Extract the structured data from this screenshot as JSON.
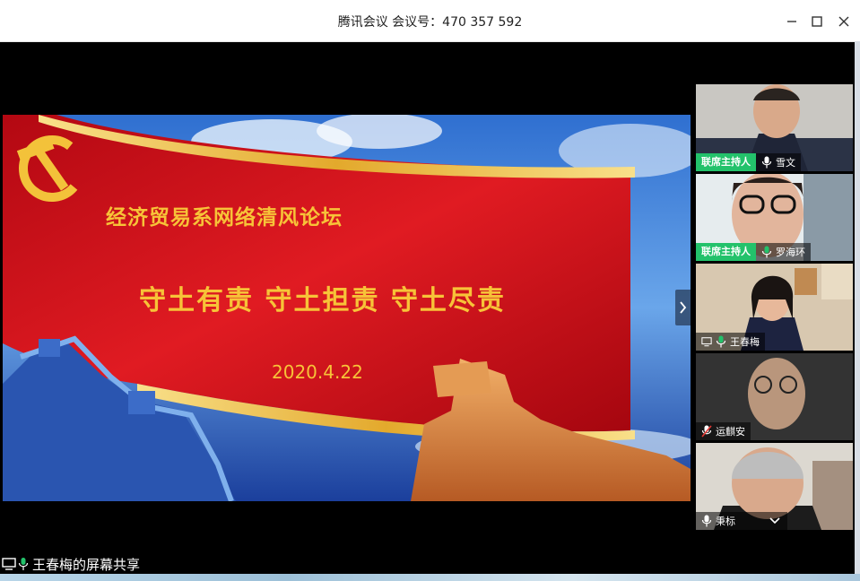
{
  "window": {
    "title": "腾讯会议 会议号：470 357 592"
  },
  "slide": {
    "heading": "经济贸易系网络清风论坛",
    "slogan": "守土有责  守土担责  守土尽责",
    "date": "2020.4.22"
  },
  "participants": [
    {
      "name": "雪文",
      "role": "联席主持人"
    },
    {
      "name": "罗海环",
      "role": "联席主持人"
    },
    {
      "name": "王春梅",
      "role": ""
    },
    {
      "name": "运麒安",
      "role": ""
    },
    {
      "name": "秉标",
      "role": ""
    }
  ],
  "share_status": "王春梅的屏幕共享",
  "colors": {
    "host_tag": "#23c26b",
    "slide_red": "#c8101a",
    "slide_gold": "#f7c338"
  }
}
